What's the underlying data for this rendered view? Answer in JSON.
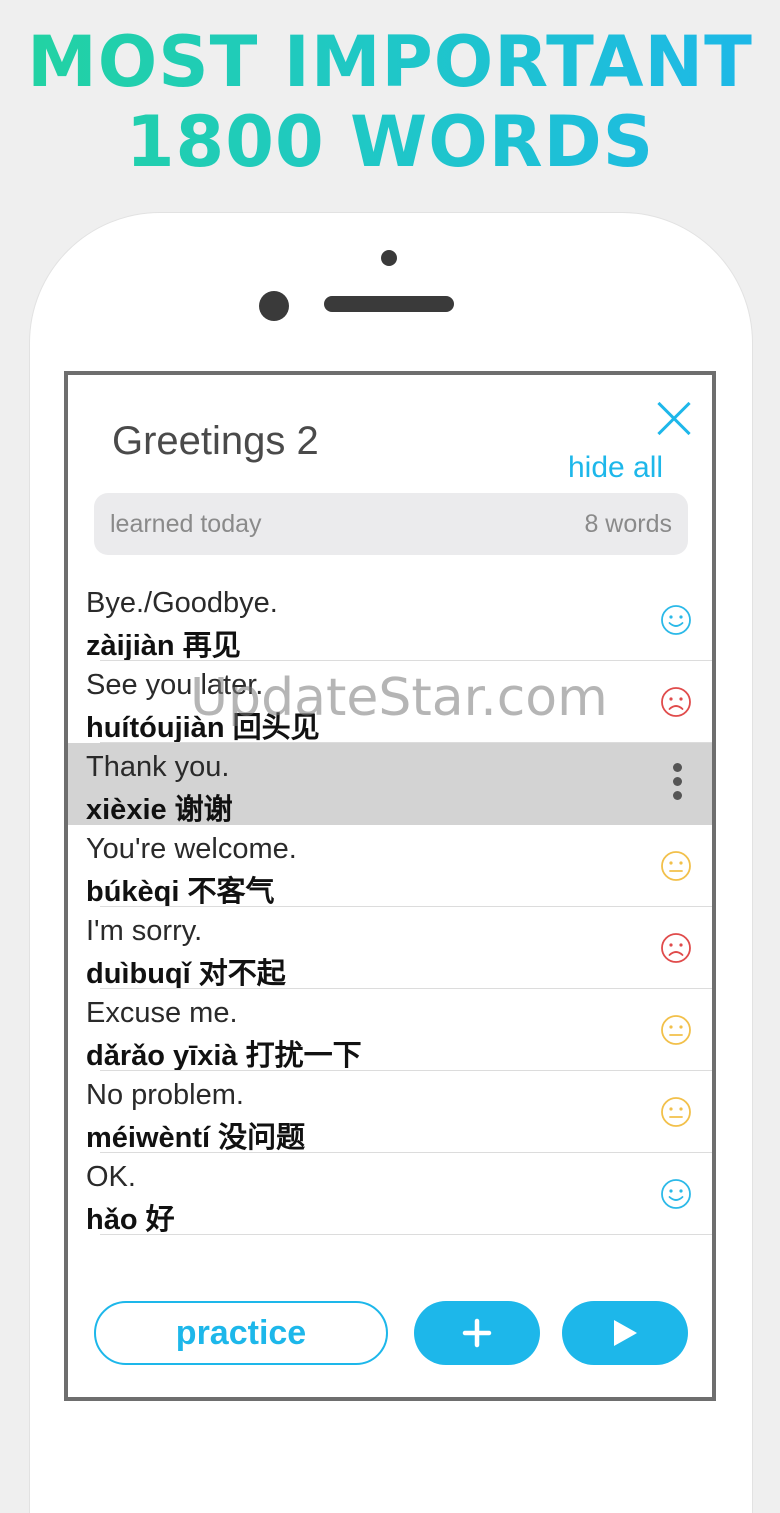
{
  "headline": {
    "line1": "MOST IMPORTANT",
    "line2": "1800 WORDS"
  },
  "screen": {
    "title": "Greetings 2",
    "hide_all_label": "hide all",
    "learned": {
      "label": "learned today",
      "count": "8 words"
    },
    "words": [
      {
        "english": "Bye./Goodbye.",
        "chinese": "zàijiàn 再见",
        "mood": "happy"
      },
      {
        "english": "See you later.",
        "chinese": "huítóujiàn 回头见",
        "mood": "sad"
      },
      {
        "english": "Thank you.",
        "chinese": "xièxie 谢谢",
        "mood": "more"
      },
      {
        "english": "You're welcome.",
        "chinese": "búkèqi 不客气",
        "mood": "neutral"
      },
      {
        "english": "I'm sorry.",
        "chinese": "duìbuqǐ 对不起",
        "mood": "sad"
      },
      {
        "english": "Excuse me.",
        "chinese": "dǎrǎo yīxià 打扰一下",
        "mood": "neutral"
      },
      {
        "english": "No problem.",
        "chinese": "méiwèntí 没问题",
        "mood": "neutral"
      },
      {
        "english": "OK.",
        "chinese": "hǎo 好",
        "mood": "happy"
      }
    ],
    "practice_label": "practice"
  },
  "colors": {
    "accent": "#1db7ea",
    "happy": "#2bb9e8",
    "neutral": "#f2c04a",
    "sad": "#e04b4b"
  },
  "icons": {
    "close": "close-icon",
    "add": "plus-icon",
    "play": "play-icon",
    "more": "more-vertical-icon"
  },
  "watermark": "UpdateStar.com"
}
